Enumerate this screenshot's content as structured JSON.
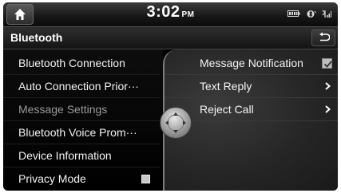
{
  "status_bar": {
    "time": "3:02",
    "time_suffix": "PM",
    "icons": [
      "battery-icon",
      "bluetooth-status-icon",
      "signal-icon"
    ]
  },
  "header": {
    "title": "Bluetooth",
    "back_icon": "back-arrow-icon",
    "home_icon": "home-icon"
  },
  "left_menu": {
    "items": [
      {
        "label": "Bluetooth Connection",
        "selected": false
      },
      {
        "label": "Auto Connection Prior···",
        "selected": false
      },
      {
        "label": "Message Settings",
        "selected": true
      },
      {
        "label": "Bluetooth Voice Prom···",
        "selected": false
      },
      {
        "label": "Device Information",
        "selected": false
      },
      {
        "label": "Privacy Mode",
        "selected": false,
        "checkbox": false
      }
    ]
  },
  "right_panel": {
    "items": [
      {
        "label": "Message Notification",
        "control": "checkbox",
        "checked": true
      },
      {
        "label": "Text Reply",
        "control": "chevron"
      },
      {
        "label": "Reject Call",
        "control": "chevron"
      }
    ]
  },
  "colors": {
    "background": "#000000",
    "selected_text": "#9a9a9a",
    "panel": "#2a2a2a",
    "text": "#f2f2f2"
  }
}
